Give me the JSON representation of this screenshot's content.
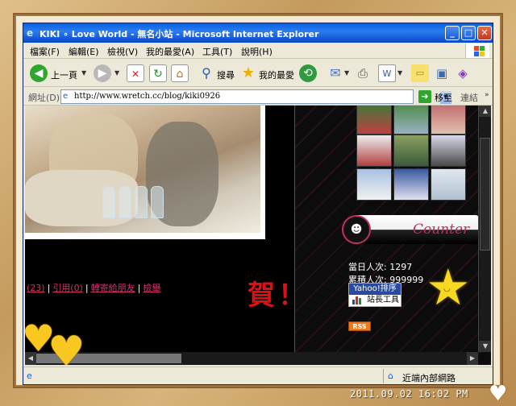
{
  "window": {
    "title": "KIKI ∘ Love World - 無名小站 - Microsoft Internet Explorer",
    "minimize": "_",
    "maximize": "□",
    "close": "✕"
  },
  "menu": {
    "items": [
      "檔案(F)",
      "編輯(E)",
      "檢視(V)",
      "我的最愛(A)",
      "工具(T)",
      "說明(H)"
    ]
  },
  "toolbar": {
    "back_label": "上一頁",
    "search_label": "搜尋",
    "favorites_label": "我的最愛"
  },
  "address": {
    "label": "網址(D)",
    "url": "http://www.wretch.cc/blog/kiki0926",
    "go_label": "移至",
    "links_label": "連結"
  },
  "page": {
    "links": [
      "(23)",
      "引用(0)",
      "轉寄給朋友",
      "檢舉"
    ],
    "congrats": "賀！！",
    "counter_word": "Counter",
    "today_visits": "當日人次: 1297",
    "total_visits": "累積人次: 999999",
    "yahoo_rank": "Yahoo!排序",
    "site_tools": "站長工具",
    "rss": "RSS"
  },
  "status": {
    "zone": "近端內部網路"
  },
  "photo_stamp": "2011.09.02  16:02 PM",
  "colors": {
    "link": "#d03070",
    "congrats": "#e01010",
    "counter": "#c03060"
  }
}
